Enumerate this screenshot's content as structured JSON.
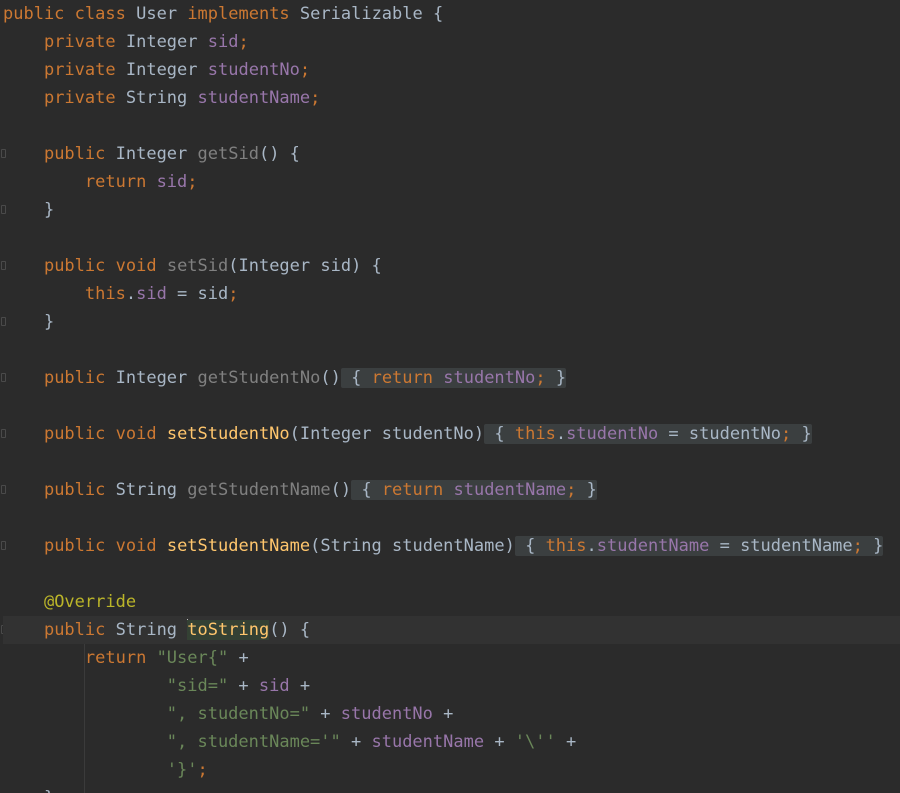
{
  "editor": {
    "language": "Java",
    "theme_colors": {
      "background": "#2b2b2b",
      "default_text": "#a9b7c6",
      "keyword": "#cc7832",
      "field": "#9876aa",
      "method": "#ffc66d",
      "string": "#6a8759",
      "annotation": "#bbb529"
    },
    "tokens": {
      "l1_public": "public",
      "l1_class": "class",
      "l1_name": "User",
      "l1_implements": "implements",
      "l1_iface": "Serializable",
      "l1_brace": "{",
      "l2_private": "private",
      "l2_type": "Integer",
      "l2_field": "sid",
      "l2_semi": ";",
      "l3_private": "private",
      "l3_type": "Integer",
      "l3_field": "studentNo",
      "l3_semi": ";",
      "l4_private": "private",
      "l4_type": "String",
      "l4_field": "studentName",
      "l4_semi": ";",
      "l6_public": "public",
      "l6_type": "Integer",
      "l6_method": "getSid",
      "l6_rest": "() {",
      "l7_return": "return",
      "l7_field": "sid",
      "l7_semi": ";",
      "l8_brace": "}",
      "l10_public": "public",
      "l10_void": "void",
      "l10_method": "setSid",
      "l10_params": "(Integer sid) {",
      "l11_this": "this",
      "l11_dot": ".",
      "l11_field": "sid",
      "l11_assign": " = sid",
      "l11_semi": ";",
      "l12_brace": "}",
      "l14_public": "public",
      "l14_type": "Integer",
      "l14_method": "getStudentNo",
      "l14_paren": "()",
      "l14_open": " {",
      "l14_return": "return",
      "l14_field": "studentNo",
      "l14_semi": ";",
      "l14_close": " }",
      "l16_public": "public",
      "l16_void": "void",
      "l16_method": "setStudentNo",
      "l16_params": "(Integer studentNo)",
      "l16_open": " {",
      "l16_this": "this",
      "l16_dot": ".",
      "l16_field": "studentNo",
      "l16_assign": " = studentNo",
      "l16_semi": ";",
      "l16_close": " }",
      "l18_public": "public",
      "l18_type": "String",
      "l18_method": "getStudentName",
      "l18_paren": "()",
      "l18_open": " {",
      "l18_return": "return",
      "l18_field": "studentName",
      "l18_semi": ";",
      "l18_close": " }",
      "l20_public": "public",
      "l20_void": "void",
      "l20_method": "setStudentName",
      "l20_params": "(String studentName)",
      "l20_open": " {",
      "l20_this": "this",
      "l20_dot": ".",
      "l20_field": "studentName",
      "l20_assign": " = studentName",
      "l20_semi": ";",
      "l20_close": " }",
      "l22_annotation": "@Override",
      "l23_public": "public",
      "l23_type": "String",
      "l23_method": "toString",
      "l23_rest": "() {",
      "l24_return": "return",
      "l24_str": "\"User{\"",
      "l24_plus": " +",
      "l25_str": "\"sid=\"",
      "l25_plus1": " + ",
      "l25_field": "sid",
      "l25_plus2": " +",
      "l26_str": "\", studentNo=\"",
      "l26_plus1": " + ",
      "l26_field": "studentNo",
      "l26_plus2": " +",
      "l27_str": "\", studentName='\"",
      "l27_plus1": " + ",
      "l27_field": "studentName",
      "l27_plus2": " + ",
      "l27_char": "'\\''",
      "l27_plus3": " +",
      "l28_str": "'}'",
      "l28_semi": ";",
      "l29_brace": "}"
    }
  }
}
